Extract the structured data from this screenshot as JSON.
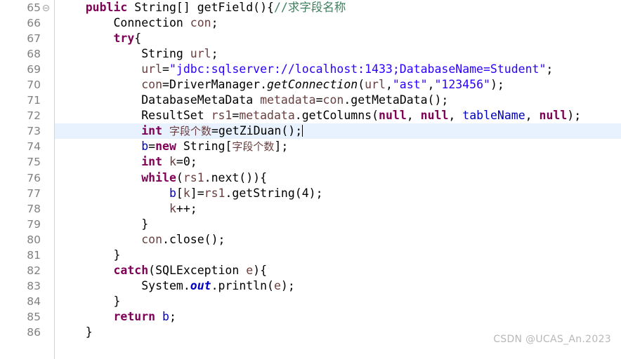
{
  "editor": {
    "language": "Java",
    "current_line": 73,
    "gutter": {
      "first_visible_line": 65,
      "last_visible_line": 86,
      "fold_marker_lines": [
        65
      ]
    },
    "colors": {
      "background": "#ffffff",
      "gutter_text": "#808080",
      "gutter_border": "#d4d4d4",
      "current_line_highlight": "#e8f2fe",
      "keyword": "#7f0055",
      "string": "#2a00ff",
      "comment": "#3f7f5f",
      "field": "#0000c0",
      "local_variable": "#6a3e3e",
      "plain_text": "#000000",
      "watermark": "#b8b8b8"
    }
  },
  "lines": [
    {
      "number": 65,
      "fold": "collapse-icon",
      "indent": 4,
      "tokens": [
        {
          "t": "public",
          "c": "kw"
        },
        {
          "t": " ",
          "c": "plain"
        },
        {
          "t": "String[] getField(){",
          "c": "plain"
        },
        {
          "t": "//求字段名称",
          "c": "cmt"
        }
      ]
    },
    {
      "number": 66,
      "fold": "",
      "indent": 8,
      "tokens": [
        {
          "t": "Connection ",
          "c": "plain"
        },
        {
          "t": "con",
          "c": "loc"
        },
        {
          "t": ";",
          "c": "plain"
        }
      ]
    },
    {
      "number": 67,
      "fold": "",
      "indent": 8,
      "tokens": [
        {
          "t": "try",
          "c": "kw"
        },
        {
          "t": "{",
          "c": "plain"
        }
      ]
    },
    {
      "number": 68,
      "fold": "",
      "indent": 12,
      "tokens": [
        {
          "t": "String ",
          "c": "plain"
        },
        {
          "t": "url",
          "c": "loc"
        },
        {
          "t": ";",
          "c": "plain"
        }
      ]
    },
    {
      "number": 69,
      "fold": "",
      "indent": 12,
      "tokens": [
        {
          "t": "url",
          "c": "loc"
        },
        {
          "t": "=",
          "c": "plain"
        },
        {
          "t": "\"jdbc:sqlserver://localhost:1433;DatabaseName=Student\"",
          "c": "str"
        },
        {
          "t": ";",
          "c": "plain"
        }
      ]
    },
    {
      "number": 70,
      "fold": "",
      "indent": 12,
      "tokens": [
        {
          "t": "con",
          "c": "loc"
        },
        {
          "t": "=DriverManager.",
          "c": "plain"
        },
        {
          "t": "getConnection",
          "c": "mth-s"
        },
        {
          "t": "(",
          "c": "plain"
        },
        {
          "t": "url",
          "c": "loc"
        },
        {
          "t": ",",
          "c": "plain"
        },
        {
          "t": "\"ast\"",
          "c": "str"
        },
        {
          "t": ",",
          "c": "plain"
        },
        {
          "t": "\"123456\"",
          "c": "str"
        },
        {
          "t": ");",
          "c": "plain"
        }
      ]
    },
    {
      "number": 71,
      "fold": "",
      "indent": 12,
      "tokens": [
        {
          "t": "DatabaseMetaData ",
          "c": "plain"
        },
        {
          "t": "metadata",
          "c": "loc"
        },
        {
          "t": "=",
          "c": "plain"
        },
        {
          "t": "con",
          "c": "loc"
        },
        {
          "t": ".getMetaData();",
          "c": "plain"
        }
      ]
    },
    {
      "number": 72,
      "fold": "",
      "indent": 12,
      "tokens": [
        {
          "t": "ResultSet ",
          "c": "plain"
        },
        {
          "t": "rs1",
          "c": "loc"
        },
        {
          "t": "=",
          "c": "plain"
        },
        {
          "t": "metadata",
          "c": "loc"
        },
        {
          "t": ".getColumns(",
          "c": "plain"
        },
        {
          "t": "null",
          "c": "kw"
        },
        {
          "t": ", ",
          "c": "plain"
        },
        {
          "t": "null",
          "c": "kw"
        },
        {
          "t": ", ",
          "c": "plain"
        },
        {
          "t": "tableName",
          "c": "fld"
        },
        {
          "t": ", ",
          "c": "plain"
        },
        {
          "t": "null",
          "c": "kw"
        },
        {
          "t": ");",
          "c": "plain"
        }
      ]
    },
    {
      "number": 73,
      "fold": "",
      "indent": 12,
      "current": true,
      "caret": true,
      "tokens": [
        {
          "t": "int",
          "c": "kw"
        },
        {
          "t": " ",
          "c": "plain"
        },
        {
          "t": "字段个数",
          "c": "loc cjk"
        },
        {
          "t": "=getZiDuan();",
          "c": "plain"
        }
      ]
    },
    {
      "number": 74,
      "fold": "",
      "indent": 12,
      "tokens": [
        {
          "t": "b",
          "c": "fld"
        },
        {
          "t": "=",
          "c": "plain"
        },
        {
          "t": "new",
          "c": "kw"
        },
        {
          "t": " String[",
          "c": "plain"
        },
        {
          "t": "字段个数",
          "c": "loc cjk"
        },
        {
          "t": "];",
          "c": "plain"
        }
      ]
    },
    {
      "number": 75,
      "fold": "",
      "indent": 12,
      "tokens": [
        {
          "t": "int",
          "c": "kw"
        },
        {
          "t": " ",
          "c": "plain"
        },
        {
          "t": "k",
          "c": "loc"
        },
        {
          "t": "=0;",
          "c": "plain"
        }
      ]
    },
    {
      "number": 76,
      "fold": "",
      "indent": 12,
      "tokens": [
        {
          "t": "while",
          "c": "kw"
        },
        {
          "t": "(",
          "c": "plain"
        },
        {
          "t": "rs1",
          "c": "loc"
        },
        {
          "t": ".next()){",
          "c": "plain"
        }
      ]
    },
    {
      "number": 77,
      "fold": "",
      "indent": 16,
      "tokens": [
        {
          "t": "b",
          "c": "fld"
        },
        {
          "t": "[",
          "c": "plain"
        },
        {
          "t": "k",
          "c": "loc"
        },
        {
          "t": "]=",
          "c": "plain"
        },
        {
          "t": "rs1",
          "c": "loc"
        },
        {
          "t": ".getString(4);",
          "c": "plain"
        }
      ]
    },
    {
      "number": 78,
      "fold": "",
      "indent": 16,
      "tokens": [
        {
          "t": "k",
          "c": "loc"
        },
        {
          "t": "++;",
          "c": "plain"
        }
      ]
    },
    {
      "number": 79,
      "fold": "",
      "indent": 12,
      "tokens": [
        {
          "t": "}",
          "c": "plain"
        }
      ]
    },
    {
      "number": 80,
      "fold": "",
      "indent": 12,
      "tokens": [
        {
          "t": "con",
          "c": "loc"
        },
        {
          "t": ".close();",
          "c": "plain"
        }
      ]
    },
    {
      "number": 81,
      "fold": "",
      "indent": 8,
      "tokens": [
        {
          "t": "}",
          "c": "plain"
        }
      ]
    },
    {
      "number": 82,
      "fold": "",
      "indent": 8,
      "tokens": [
        {
          "t": "catch",
          "c": "kw"
        },
        {
          "t": "(SQLException ",
          "c": "plain"
        },
        {
          "t": "e",
          "c": "loc"
        },
        {
          "t": "){",
          "c": "plain"
        }
      ]
    },
    {
      "number": 83,
      "fold": "",
      "indent": 12,
      "tokens": [
        {
          "t": "System.",
          "c": "plain"
        },
        {
          "t": "out",
          "c": "fld-s"
        },
        {
          "t": ".println(",
          "c": "plain"
        },
        {
          "t": "e",
          "c": "loc"
        },
        {
          "t": ");",
          "c": "plain"
        }
      ]
    },
    {
      "number": 84,
      "fold": "",
      "indent": 8,
      "tokens": [
        {
          "t": "}",
          "c": "plain"
        }
      ]
    },
    {
      "number": 85,
      "fold": "",
      "indent": 8,
      "tokens": [
        {
          "t": "return",
          "c": "kw"
        },
        {
          "t": " ",
          "c": "plain"
        },
        {
          "t": "b",
          "c": "fld"
        },
        {
          "t": ";",
          "c": "plain"
        }
      ]
    },
    {
      "number": 86,
      "fold": "",
      "indent": 4,
      "tokens": [
        {
          "t": "}",
          "c": "plain"
        }
      ]
    }
  ],
  "watermark": {
    "text": "CSDN @UCAS_An.2023"
  }
}
